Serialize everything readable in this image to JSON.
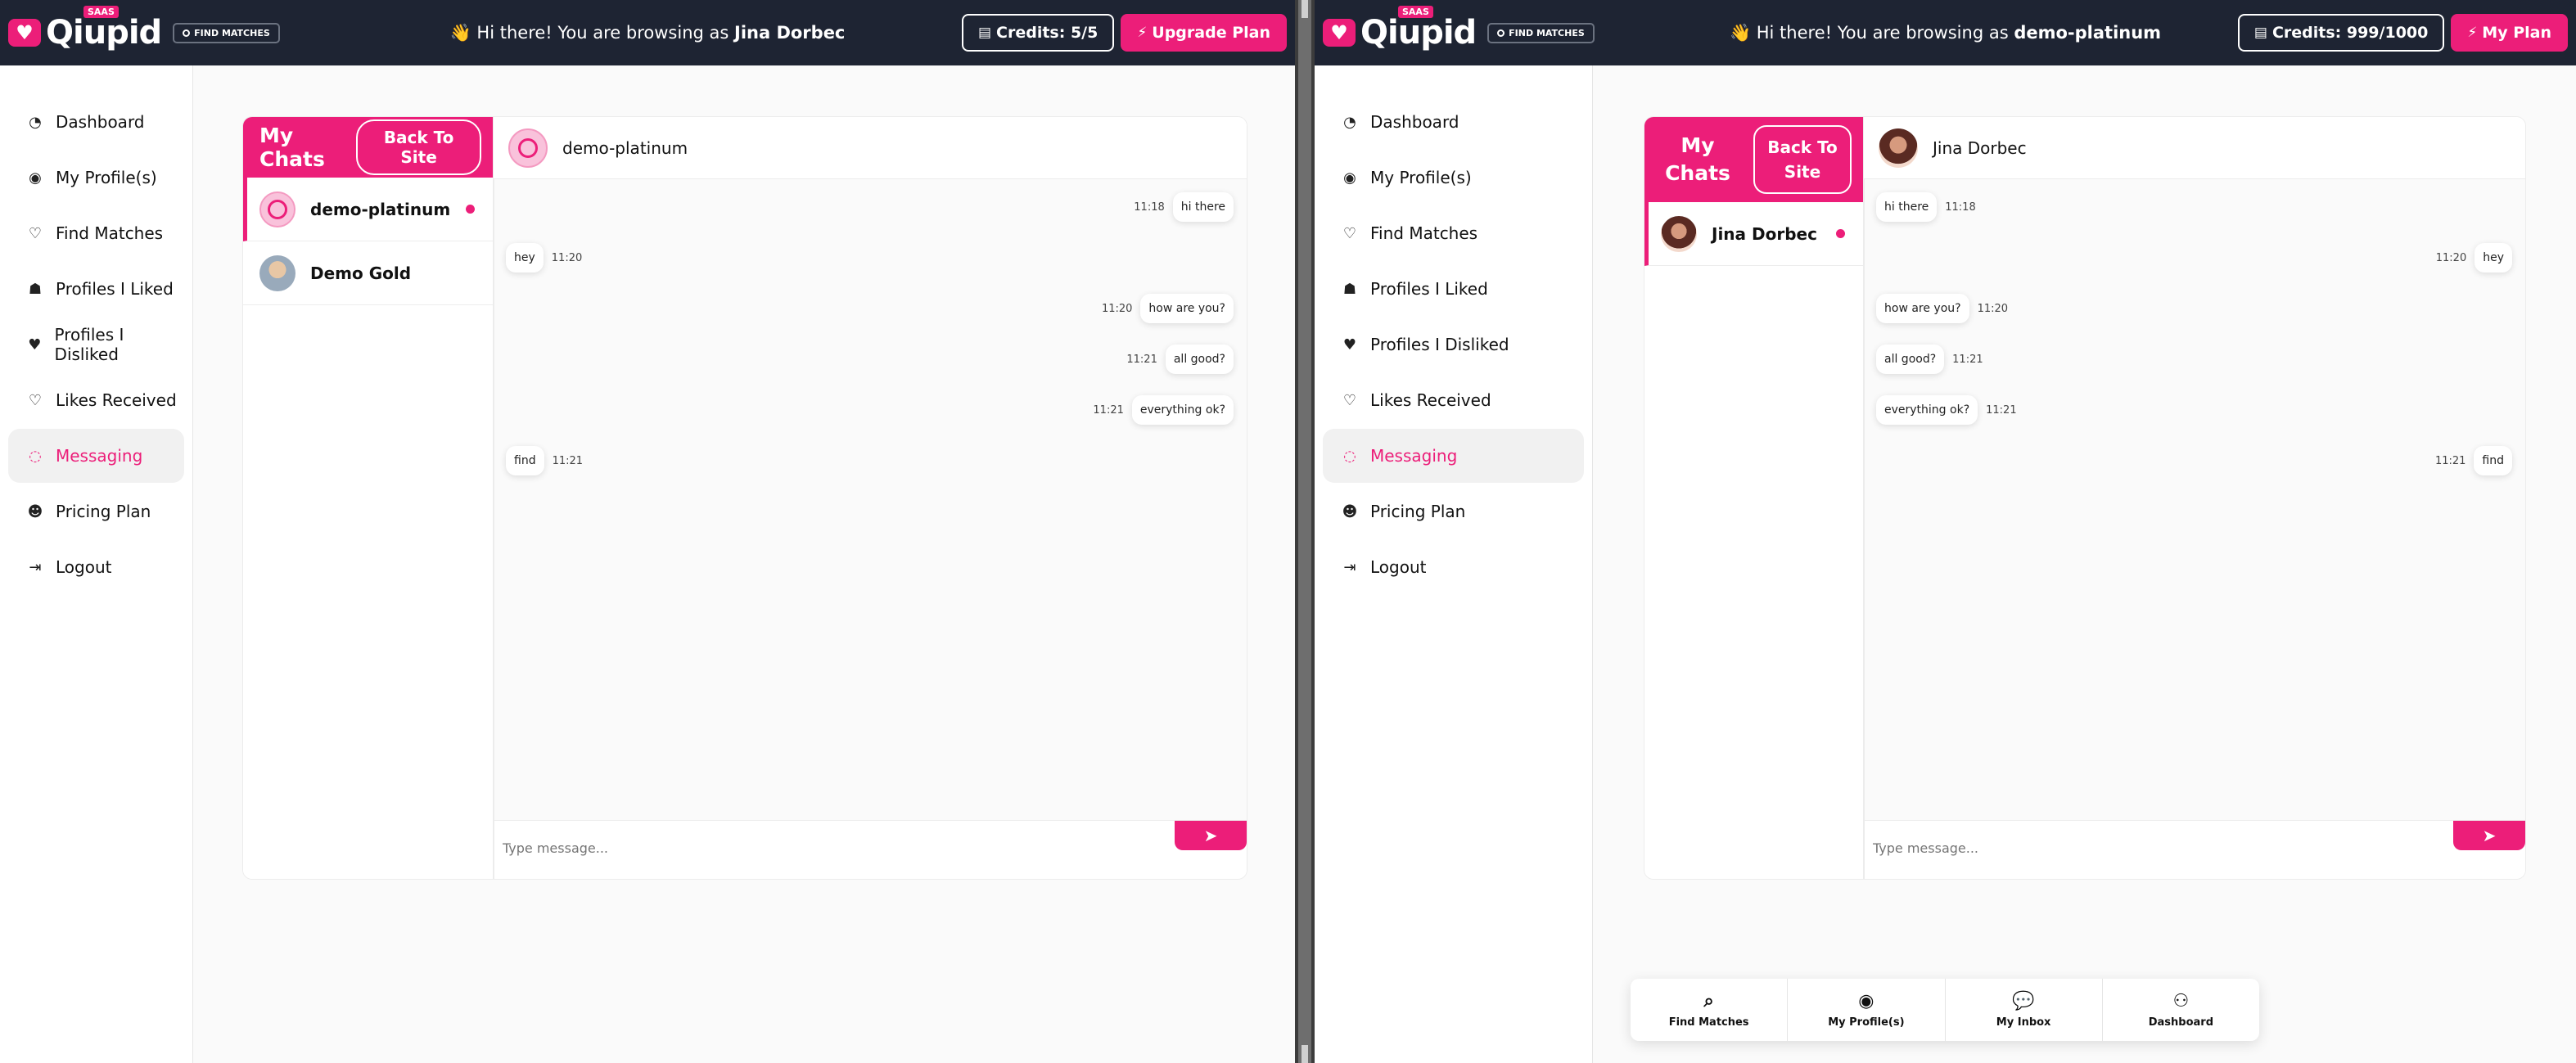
{
  "left": {
    "topbar": {
      "brand": "Qiupid",
      "saas_badge": "SAAS",
      "find_matches": "FIND MATCHES",
      "greeting_prefix": "👋 Hi there! You are browsing as ",
      "greeting_user": "Jina Dorbec",
      "credits": "Credits: 5/5",
      "upgrade": "Upgrade Plan"
    },
    "sidebar": [
      {
        "label": "Dashboard",
        "icon": "dashboard-icon"
      },
      {
        "label": "My Profile(s)",
        "icon": "user-circle-icon"
      },
      {
        "label": "Find Matches",
        "icon": "heart-icon"
      },
      {
        "label": "Profiles I Liked",
        "icon": "user-hand-icon"
      },
      {
        "label": "Profiles I Disliked",
        "icon": "broken-heart-icon"
      },
      {
        "label": "Likes Received",
        "icon": "heart-icon"
      },
      {
        "label": "Messaging",
        "icon": "chat-icon",
        "active": true
      },
      {
        "label": "Pricing Plan",
        "icon": "users-icon"
      },
      {
        "label": "Logout",
        "icon": "logout-icon"
      }
    ],
    "chats": {
      "title": "My Chats",
      "back": "Back To Site",
      "items": [
        {
          "name": "demo-platinum",
          "active": true,
          "unread": true
        },
        {
          "name": "Demo Gold",
          "active": false,
          "unread": false
        }
      ]
    },
    "conversation": {
      "with": "demo-platinum",
      "messages": [
        {
          "text": "hi there",
          "time": "11:18",
          "mine": true
        },
        {
          "text": "hey",
          "time": "11:20",
          "mine": false
        },
        {
          "text": "how are you?",
          "time": "11:20",
          "mine": true
        },
        {
          "text": "all good?",
          "time": "11:21",
          "mine": true
        },
        {
          "text": "everything ok?",
          "time": "11:21",
          "mine": true
        },
        {
          "text": "find",
          "time": "11:21",
          "mine": false
        }
      ],
      "placeholder": "Type message..."
    }
  },
  "right": {
    "topbar": {
      "brand": "Qiupid",
      "saas_badge": "SAAS",
      "find_matches": "FIND MATCHES",
      "greeting_prefix": "👋 Hi there! You are browsing as ",
      "greeting_user": "demo-platinum",
      "credits": "Credits: 999/1000",
      "upgrade": "My Plan"
    },
    "sidebar": [
      {
        "label": "Dashboard",
        "icon": "dashboard-icon"
      },
      {
        "label": "My Profile(s)",
        "icon": "user-circle-icon"
      },
      {
        "label": "Find Matches",
        "icon": "heart-icon"
      },
      {
        "label": "Profiles I Liked",
        "icon": "user-hand-icon"
      },
      {
        "label": "Profiles I Disliked",
        "icon": "broken-heart-icon"
      },
      {
        "label": "Likes Received",
        "icon": "heart-icon"
      },
      {
        "label": "Messaging",
        "icon": "chat-icon",
        "active": true
      },
      {
        "label": "Pricing Plan",
        "icon": "users-icon"
      },
      {
        "label": "Logout",
        "icon": "logout-icon"
      }
    ],
    "chats": {
      "title": "My Chats",
      "back": "Back To Site",
      "items": [
        {
          "name": "Jina Dorbec",
          "active": true,
          "unread": true
        }
      ]
    },
    "conversation": {
      "with": "Jina Dorbec",
      "messages": [
        {
          "text": "hi there",
          "time": "11:18",
          "mine": false
        },
        {
          "text": "hey",
          "time": "11:20",
          "mine": true
        },
        {
          "text": "how are you?",
          "time": "11:20",
          "mine": false
        },
        {
          "text": "all good?",
          "time": "11:21",
          "mine": false
        },
        {
          "text": "everything ok?",
          "time": "11:21",
          "mine": false
        },
        {
          "text": "find",
          "time": "11:21",
          "mine": true
        }
      ],
      "placeholder": "Type message..."
    },
    "bottom_nav": [
      {
        "label": "Find Matches",
        "icon": "search-icon"
      },
      {
        "label": "My Profile(s)",
        "icon": "user-circle-icon"
      },
      {
        "label": "My Inbox",
        "icon": "chat-icon"
      },
      {
        "label": "Dashboard",
        "icon": "user-icon"
      }
    ]
  },
  "colors": {
    "accent": "#ec1e79",
    "topbar": "#1e2433"
  }
}
